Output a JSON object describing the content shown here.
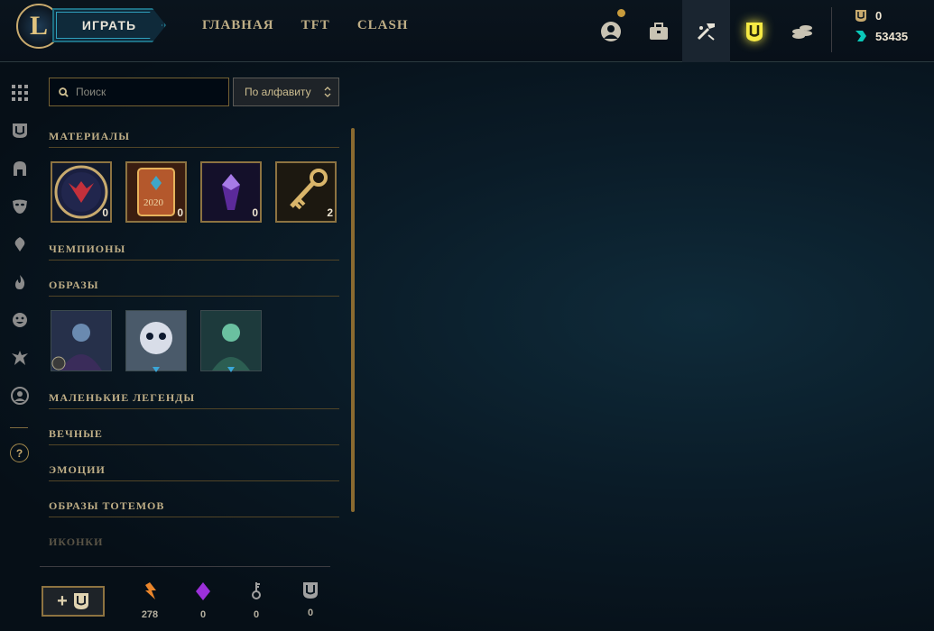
{
  "header": {
    "logo_letter": "L",
    "play_label": "ИГРАТЬ",
    "nav": [
      "ГЛАВНАЯ",
      "TFT",
      "CLASH"
    ],
    "currency": {
      "blue_essence": "0",
      "riot_points": "53435"
    }
  },
  "sidebar_icons": [
    "grid-icon",
    "shield-icon",
    "helmet-icon",
    "mask-icon",
    "ward-icon",
    "flame-icon",
    "emote-icon",
    "totem-icon",
    "profile-icon"
  ],
  "help_label": "?",
  "search": {
    "placeholder": "Поиск"
  },
  "sort": {
    "label": "По алфавиту"
  },
  "sections": {
    "materials": "МАТЕРИАЛЫ",
    "champions": "ЧЕМПИОНЫ",
    "skins": "ОБРАЗЫ",
    "little_legends": "МАЛЕНЬКИЕ ЛЕГЕНДЫ",
    "eternals": "ВЕЧНЫЕ",
    "emotes": "ЭМОЦИИ",
    "totem_skins": "ОБРАЗЫ ТОТЕМОВ",
    "icons": "ИКОНКИ"
  },
  "materials": [
    {
      "name": "orb",
      "count": "0"
    },
    {
      "name": "2020 capsule",
      "label": "2020",
      "count": "0"
    },
    {
      "name": "gem",
      "count": "0"
    },
    {
      "name": "key fragment",
      "count": "2"
    }
  ],
  "bottom": {
    "add_label": "+",
    "currencies": [
      {
        "icon": "orange-essence-icon",
        "value": "278"
      },
      {
        "icon": "gem-icon",
        "value": "0"
      },
      {
        "icon": "key-icon",
        "value": "0"
      },
      {
        "icon": "chest-icon",
        "value": "0"
      }
    ]
  },
  "colors": {
    "gold": "#c8aa6e",
    "accent": "#0ac8b9",
    "background": "#0a1b27"
  }
}
